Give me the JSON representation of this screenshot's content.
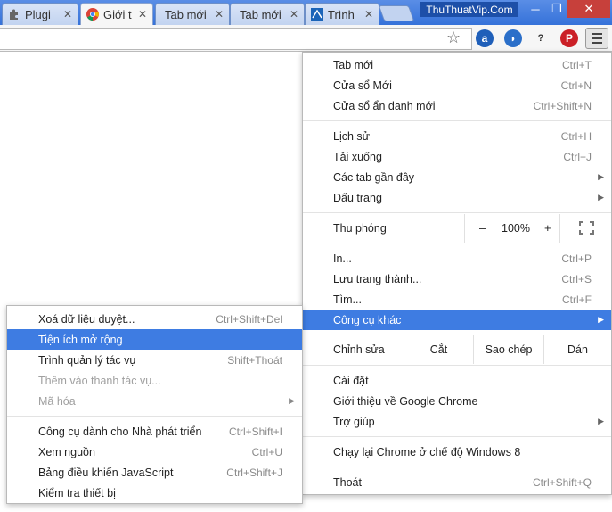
{
  "tabs": [
    {
      "label": "Plugi",
      "close": "✕",
      "icon": "puzzle-icon"
    },
    {
      "label": "Giới t",
      "close": "✕",
      "icon": "chrome-icon",
      "active": true
    },
    {
      "label": "Tab mới",
      "close": "✕"
    },
    {
      "label": "Tab mới",
      "close": "✕"
    },
    {
      "label": "Trình",
      "close": "✕",
      "icon": "site-icon"
    }
  ],
  "brand_watermark": "ThuThuatVip.Com",
  "window_controls": {
    "minimize": "─",
    "maximize": "❐",
    "close": "✕"
  },
  "toolbar": {
    "star": "☆",
    "ext_a": "a",
    "ext_b": "◗",
    "ext_c": "?",
    "ext_d": "P"
  },
  "main_menu": {
    "new_tab": {
      "label": "Tab mới",
      "shortcut": "Ctrl+T"
    },
    "new_window": {
      "label": "Cửa sổ Mới",
      "shortcut": "Ctrl+N"
    },
    "incognito": {
      "label": "Cửa sổ ẩn danh mới",
      "shortcut": "Ctrl+Shift+N"
    },
    "history": {
      "label": "Lịch sử",
      "shortcut": "Ctrl+H"
    },
    "downloads": {
      "label": "Tải xuống",
      "shortcut": "Ctrl+J"
    },
    "recent_tabs": {
      "label": "Các tab gần đây"
    },
    "bookmarks": {
      "label": "Dấu trang"
    },
    "zoom": {
      "label": "Thu phóng",
      "minus": "–",
      "value": "100%",
      "plus": "+"
    },
    "print": {
      "label": "In...",
      "shortcut": "Ctrl+P"
    },
    "save_page": {
      "label": "Lưu trang thành...",
      "shortcut": "Ctrl+S"
    },
    "find": {
      "label": "Tìm...",
      "shortcut": "Ctrl+F"
    },
    "more_tools": {
      "label": "Công cụ khác"
    },
    "edit": {
      "label": "Chỉnh sửa",
      "cut": "Cắt",
      "copy": "Sao chép",
      "paste": "Dán"
    },
    "settings": {
      "label": "Cài đặt"
    },
    "about": {
      "label": "Giới thiệu về Google Chrome"
    },
    "help": {
      "label": "Trợ giúp"
    },
    "relaunch": {
      "label": "Chạy lại Chrome ở chế độ Windows 8"
    },
    "exit": {
      "label": "Thoát",
      "shortcut": "Ctrl+Shift+Q"
    }
  },
  "submenu": {
    "clear_data": {
      "label": "Xoá dữ liệu duyệt...",
      "shortcut": "Ctrl+Shift+Del"
    },
    "extensions": {
      "label": "Tiện ích mở rộng"
    },
    "task_manager": {
      "label": "Trình quản lý tác vụ",
      "shortcut": "Shift+Thoát"
    },
    "add_taskbar": {
      "label": "Thêm vào thanh tác vụ..."
    },
    "encoding": {
      "label": "Mã hóa"
    },
    "dev_tools": {
      "label": "Công cụ dành cho Nhà phát triển",
      "shortcut": "Ctrl+Shift+I"
    },
    "view_source": {
      "label": "Xem nguồn",
      "shortcut": "Ctrl+U"
    },
    "js_console": {
      "label": "Bảng điều khiển JavaScript",
      "shortcut": "Ctrl+Shift+J"
    },
    "inspect_devices": {
      "label": "Kiểm tra thiết bị"
    }
  },
  "colors": {
    "highlight": "#3e7ce2",
    "tabstrip": "#3572d9",
    "close_button": "#c7403b"
  }
}
